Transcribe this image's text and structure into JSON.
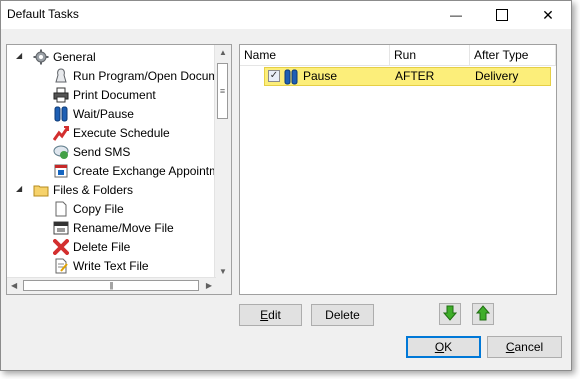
{
  "window": {
    "title": "Default Tasks",
    "minimize_glyph": "—",
    "close_glyph": "✕"
  },
  "tree": {
    "expanded_glyph": "◢",
    "groups": [
      {
        "label": "General",
        "icon": "gear-icon",
        "items": [
          {
            "label": "Run Program/Open Document",
            "icon": "run-program-icon"
          },
          {
            "label": "Print Document",
            "icon": "printer-icon"
          },
          {
            "label": "Wait/Pause",
            "icon": "pause-icon"
          },
          {
            "label": "Execute Schedule",
            "icon": "execute-schedule-icon"
          },
          {
            "label": "Send SMS",
            "icon": "sms-icon"
          },
          {
            "label": "Create Exchange Appointment",
            "icon": "exchange-appointment-icon"
          }
        ]
      },
      {
        "label": "Files & Folders",
        "icon": "folder-icon",
        "items": [
          {
            "label": "Copy File",
            "icon": "copy-file-icon"
          },
          {
            "label": "Rename/Move File",
            "icon": "rename-file-icon"
          },
          {
            "label": "Delete File",
            "icon": "delete-file-icon"
          },
          {
            "label": "Write Text File",
            "icon": "write-text-file-icon"
          }
        ]
      }
    ]
  },
  "scrollbars": {
    "up_arrow": "▲",
    "down_arrow": "▼",
    "left_arrow": "◀",
    "right_arrow": "▶",
    "vthumb_grip": "≡",
    "hthumb_grip": "|||"
  },
  "grid": {
    "columns": [
      "Name",
      "Run",
      "After Type"
    ],
    "rows": [
      {
        "checked": true,
        "check_glyph": "✓",
        "icon": "pause-icon",
        "name": "Pause",
        "run": "AFTER",
        "after_type": "Delivery"
      }
    ],
    "selected_row_color": "#fcee7a"
  },
  "buttons": {
    "edit": {
      "label": "Edit",
      "mnemonic": "E",
      "rest": "dit"
    },
    "delete": {
      "label": "Delete"
    },
    "ok": {
      "label": "OK",
      "mnemonic": "O",
      "rest": "K"
    },
    "cancel": {
      "label": "Cancel",
      "mnemonic": "C",
      "rest": "ancel"
    },
    "move_down": {
      "icon": "green-down-arrow-icon"
    },
    "move_up": {
      "icon": "green-up-arrow-icon"
    }
  }
}
